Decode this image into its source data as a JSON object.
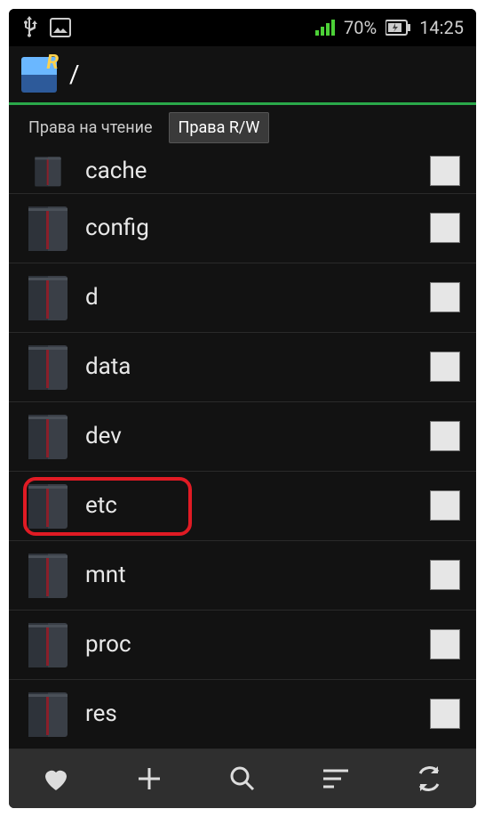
{
  "statusbar": {
    "battery_pct": "70%",
    "time": "14:25"
  },
  "appbar": {
    "path": "/"
  },
  "tabs": {
    "read_label": "Права на чтение",
    "rw_label": "Права R/W"
  },
  "files": [
    {
      "name": "cache"
    },
    {
      "name": "config"
    },
    {
      "name": "d"
    },
    {
      "name": "data"
    },
    {
      "name": "dev"
    },
    {
      "name": "etc"
    },
    {
      "name": "mnt"
    },
    {
      "name": "proc"
    },
    {
      "name": "res"
    }
  ],
  "highlighted_index": 5,
  "bottombar": {
    "favorites": "favorites",
    "add": "add",
    "search": "search",
    "sort": "sort",
    "refresh": "refresh"
  }
}
